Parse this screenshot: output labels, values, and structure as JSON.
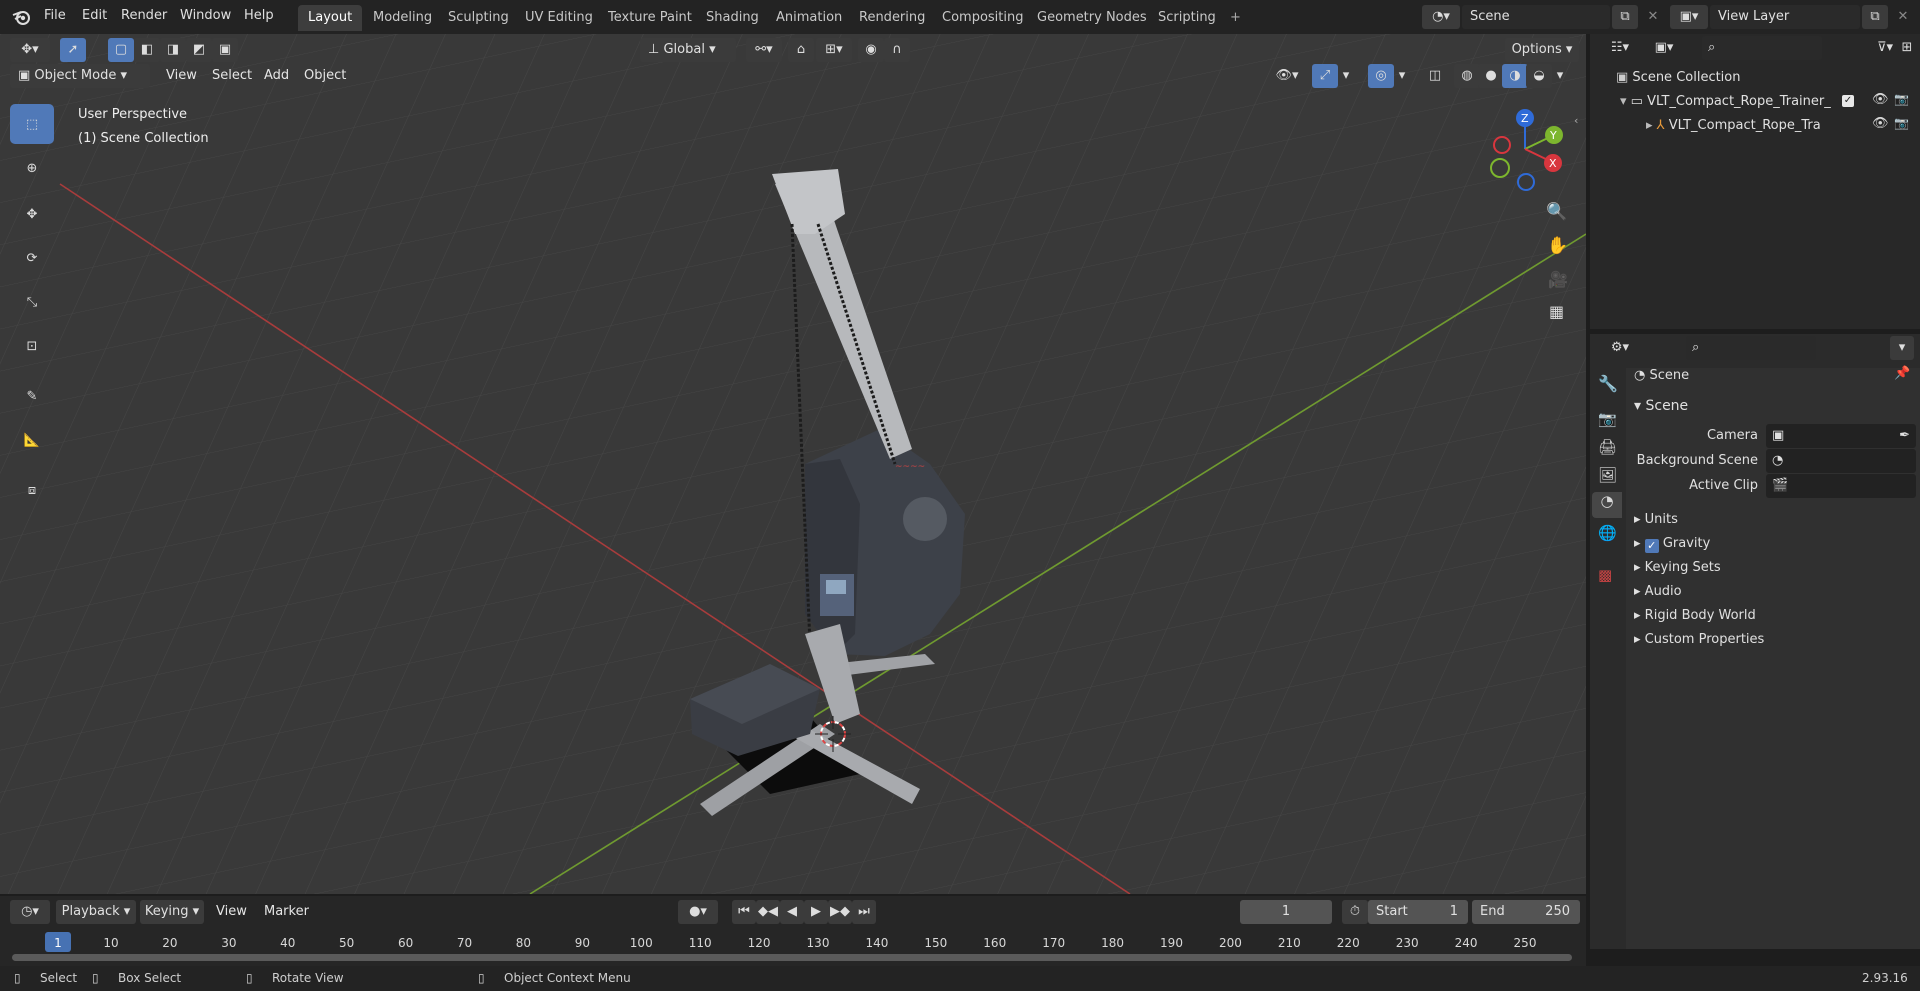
{
  "menu": {
    "file": "File",
    "edit": "Edit",
    "render": "Render",
    "window": "Window",
    "help": "Help"
  },
  "workspace_tabs": [
    "Layout",
    "Modeling",
    "Sculpting",
    "UV Editing",
    "Texture Paint",
    "Shading",
    "Animation",
    "Rendering",
    "Compositing",
    "Geometry Nodes",
    "Scripting"
  ],
  "active_workspace": "Layout",
  "scene_field": "Scene",
  "view_layer_field": "View Layer",
  "viewport_header": {
    "transform_orientation": "Global",
    "options_label": "Options",
    "mode": "Object Mode",
    "menus": [
      "View",
      "Select",
      "Add",
      "Object"
    ]
  },
  "viewport": {
    "perspective_label": "User Perspective",
    "collection_label": "(1) Scene Collection",
    "gizmo": {
      "x": "X",
      "y": "Y",
      "z": "Z"
    }
  },
  "outliner": {
    "root": "Scene Collection",
    "items": [
      {
        "label": "VLT_Compact_Rope_Trainer_",
        "type": "collection"
      },
      {
        "label": "VLT_Compact_Rope_Tra",
        "type": "object"
      }
    ]
  },
  "properties": {
    "header": "Scene",
    "panel_title": "Scene",
    "camera_label": "Camera",
    "background_scene_label": "Background Scene",
    "active_clip_label": "Active Clip",
    "sections": [
      "Units",
      "Gravity",
      "Keying Sets",
      "Audio",
      "Rigid Body World",
      "Custom Properties"
    ],
    "gravity_checked": true
  },
  "timeline": {
    "menus": [
      "Playback",
      "Keying",
      "View",
      "Marker"
    ],
    "current_frame": "1",
    "start_label": "Start",
    "start_value": "1",
    "end_label": "End",
    "end_value": "250",
    "ruler": [
      "1",
      "10",
      "20",
      "30",
      "40",
      "50",
      "60",
      "70",
      "80",
      "90",
      "100",
      "110",
      "120",
      "130",
      "140",
      "150",
      "160",
      "170",
      "180",
      "190",
      "200",
      "210",
      "220",
      "230",
      "240",
      "250"
    ]
  },
  "statusbar": {
    "select": "Select",
    "box_select": "Box Select",
    "rotate_view": "Rotate View",
    "context_menu": "Object Context Menu",
    "version": "2.93.16"
  },
  "colors": {
    "accent": "#5079b8",
    "axis_x": "#b03a3a",
    "axis_y": "#6e9a2c",
    "viewport_bg": "#393939"
  }
}
